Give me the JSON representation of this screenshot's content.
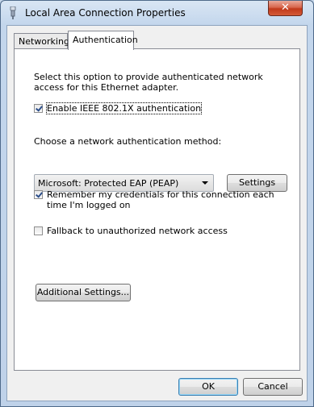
{
  "window": {
    "title": "Local Area Connection Properties",
    "close_glyph": "✕"
  },
  "tabs": [
    {
      "label": "Networking"
    },
    {
      "label": "Authentication",
      "selected": true
    }
  ],
  "auth": {
    "description": "Select this option to provide authenticated network access for this Ethernet adapter.",
    "enable_8021x": {
      "label": "Enable IEEE 802.1X authentication",
      "checked": true
    },
    "method_label": "Choose a network authentication method:",
    "method_value": "Microsoft: Protected EAP (PEAP)",
    "settings_label": "Settings",
    "remember_credentials": {
      "label_line1": "Remember my credentials for this connection each",
      "label_line2": "time I'm logged on",
      "checked": true
    },
    "fallback": {
      "label": "Fallback to unauthorized network access",
      "checked": false
    },
    "additional_settings_label": "Additional Settings..."
  },
  "footer": {
    "ok_label": "OK",
    "cancel_label": "Cancel"
  }
}
